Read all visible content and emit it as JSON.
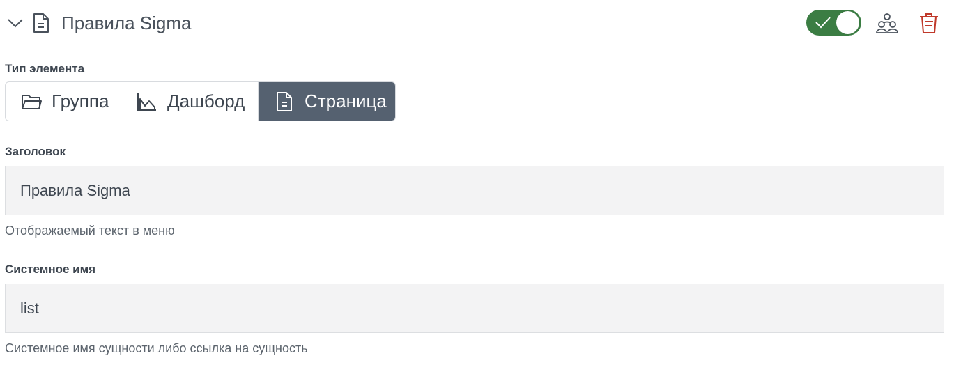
{
  "header": {
    "title": "Правила Sigma",
    "enabled": true,
    "accent_color": "#3b7d43",
    "danger_color": "#c0392b",
    "icons": [
      "chevron-down-icon",
      "document-icon",
      "check-icon",
      "users-icon",
      "trash-icon"
    ]
  },
  "element_type": {
    "label": "Тип элемента",
    "options": [
      {
        "label": "Группа",
        "icon": "folder-icon",
        "selected": false
      },
      {
        "label": "Дашборд",
        "icon": "chart-icon",
        "selected": false
      },
      {
        "label": "Страница",
        "icon": "document-icon",
        "selected": true
      }
    ],
    "selected_color": "#556170"
  },
  "title_field": {
    "label": "Заголовок",
    "value": "Правила Sigma",
    "hint": "Отображаемый текст в меню"
  },
  "system_name_field": {
    "label": "Системное имя",
    "value": "list",
    "hint": "Системное имя сущности либо ссылка на сущность"
  }
}
